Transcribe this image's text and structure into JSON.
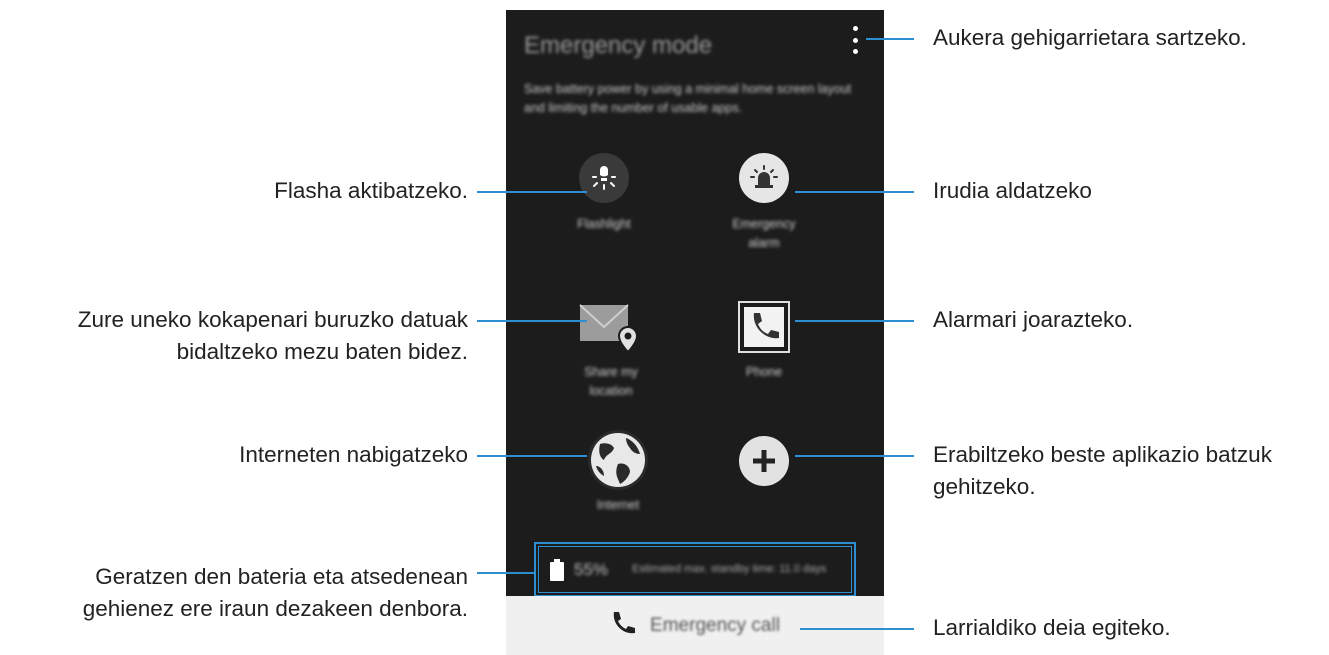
{
  "screen": {
    "title": "Emergency mode",
    "description": "Save battery power by using a minimal home screen layout and limiting the number of usable apps.",
    "apps": [
      {
        "label": "Flashlight",
        "icon": "flashlight-icon"
      },
      {
        "label": "Emergency alarm",
        "icon": "siren-icon"
      },
      {
        "label": "Share my location",
        "icon": "share-location-icon"
      },
      {
        "label": "Phone",
        "icon": "phone-icon"
      },
      {
        "label": "Internet",
        "icon": "globe-icon"
      },
      {
        "label": "",
        "icon": "add-icon"
      }
    ],
    "battery": {
      "percent": "55%",
      "estimate": "Estimated max. standby time: 11.0 days"
    },
    "emergency_call": "Emergency call"
  },
  "annotations": {
    "more_options": "Aukera gehigarrietara sartzeko.",
    "flashlight": "Flasha aktibatzeko.",
    "alarm": "Irudia aldatzeko",
    "share_location_line1": "Zure uneko kokapenari buruzko datuak",
    "share_location_line2": "bidaltzeko mezu baten bidez.",
    "phone": "Alarmari joarazteko.",
    "internet": "Interneten nabigatzeko",
    "add_line1": "Erabiltzeko beste aplikazio batzuk",
    "add_line2": "gehitzeko.",
    "battery_line1": "Geratzen den bateria eta atsedenean",
    "battery_line2": "gehienez ere iraun dezakeen denbora.",
    "emergency_call": "Larrialdiko deia egiteko."
  },
  "colors": {
    "accent": "#2d8ed1",
    "screen_bg": "#1c1c1c",
    "call_bar_bg": "#f0f0f0"
  }
}
